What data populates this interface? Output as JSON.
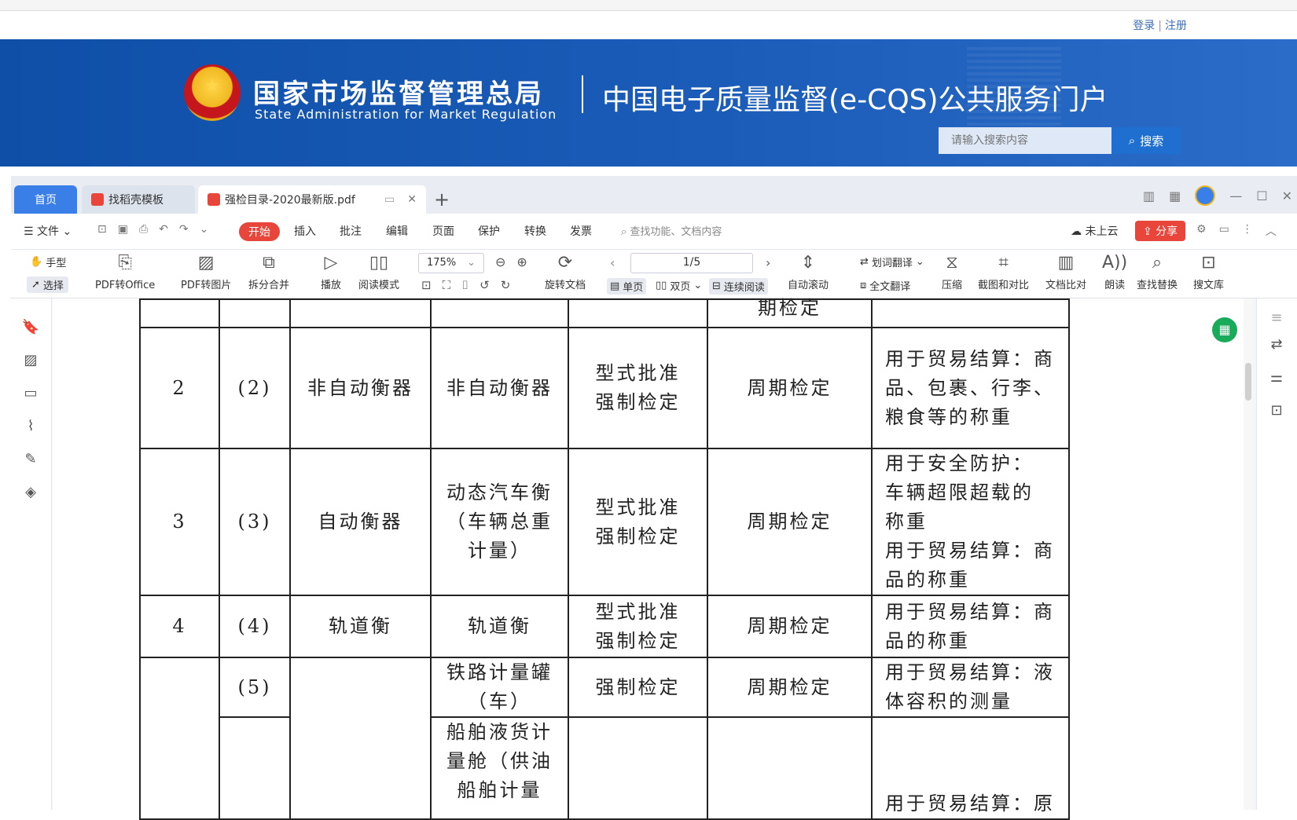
{
  "site": {
    "login": "登录",
    "separator": "|",
    "register": "注册",
    "agency_cn": "国家市场监督管理总局",
    "agency_en": "State Administration for Market Regulation",
    "portal_title": "中国电子质量监督(e-CQS)公共服务门户",
    "search_placeholder": "请输入搜索内容",
    "search_button": "搜索"
  },
  "tabs": {
    "home": "首页",
    "template": "找稻壳模板",
    "document": "强检目录-2020最新版.pdf",
    "add": "+"
  },
  "menu": {
    "file": "文件",
    "start": "开始",
    "insert": "插入",
    "annotate": "批注",
    "edit": "编辑",
    "page": "页面",
    "protect": "保护",
    "convert": "转换",
    "invoice": "发票",
    "func_search": "查找功能、文档内容",
    "cloud": "未上云",
    "share": "分享"
  },
  "toolbar": {
    "hand": "手型",
    "select": "选择",
    "pdf_office": "PDF转Office",
    "pdf_image": "PDF转图片",
    "split_merge": "拆分合并",
    "play": "播放",
    "read_mode": "阅读模式",
    "zoom": "175%",
    "rotate": "旋转文档",
    "page_indicator": "1/5",
    "single": "单页",
    "double": "双页",
    "continuous": "连续阅读",
    "auto_scroll": "自动滚动",
    "word_translate": "划词翻译",
    "full_translate": "全文翻译",
    "compress": "压缩",
    "screenshot_compare": "截图和对比",
    "doc_compare": "文档比对",
    "read_aloud": "朗读",
    "find_replace": "查找替换",
    "search_lib": "搜文库"
  },
  "table": {
    "top_partial": "期检定",
    "rows": [
      {
        "no": "2",
        "sub": "(2)",
        "cat": "非自动衡器",
        "name": "非自动衡器",
        "method_1": "型式批准",
        "method_2": "强制检定",
        "cycle": "周期检定",
        "use_1": "用于贸易结算：商",
        "use_2": "品、包裹、行李、",
        "use_3": "粮食等的称重"
      },
      {
        "no": "3",
        "sub": "(3)",
        "cat": "自动衡器",
        "name_1": "动态汽车衡",
        "name_2": "（车辆总重",
        "name_3": "计量）",
        "method_1": "型式批准",
        "method_2": "强制检定",
        "cycle": "周期检定",
        "use_1": "用于安全防护：",
        "use_2": "车辆超限超载的",
        "use_3": "称重",
        "use_4": "用于贸易结算：商",
        "use_5": "品的称重"
      },
      {
        "no": "4",
        "sub": "(4)",
        "cat": "轨道衡",
        "name": "轨道衡",
        "method_1": "型式批准",
        "method_2": "强制检定",
        "cycle": "周期检定",
        "use_1": "用于贸易结算：商",
        "use_2": "品的称重"
      },
      {
        "sub": "(5)",
        "name_1": "铁路计量罐",
        "name_2": "（车）",
        "method": "强制检定",
        "cycle": "周期检定",
        "use_1": "用于贸易结算：液",
        "use_2": "体容积的测量"
      },
      {
        "name_1": "船舶液货计",
        "name_2": "量舱（供油",
        "name_3": "船舶计量",
        "use_1": "用于贸易结算：原"
      }
    ]
  },
  "colors": {
    "banner": "#1a5cb8",
    "accent_red": "#e8463a",
    "tab_blue": "#3a7ee8"
  }
}
